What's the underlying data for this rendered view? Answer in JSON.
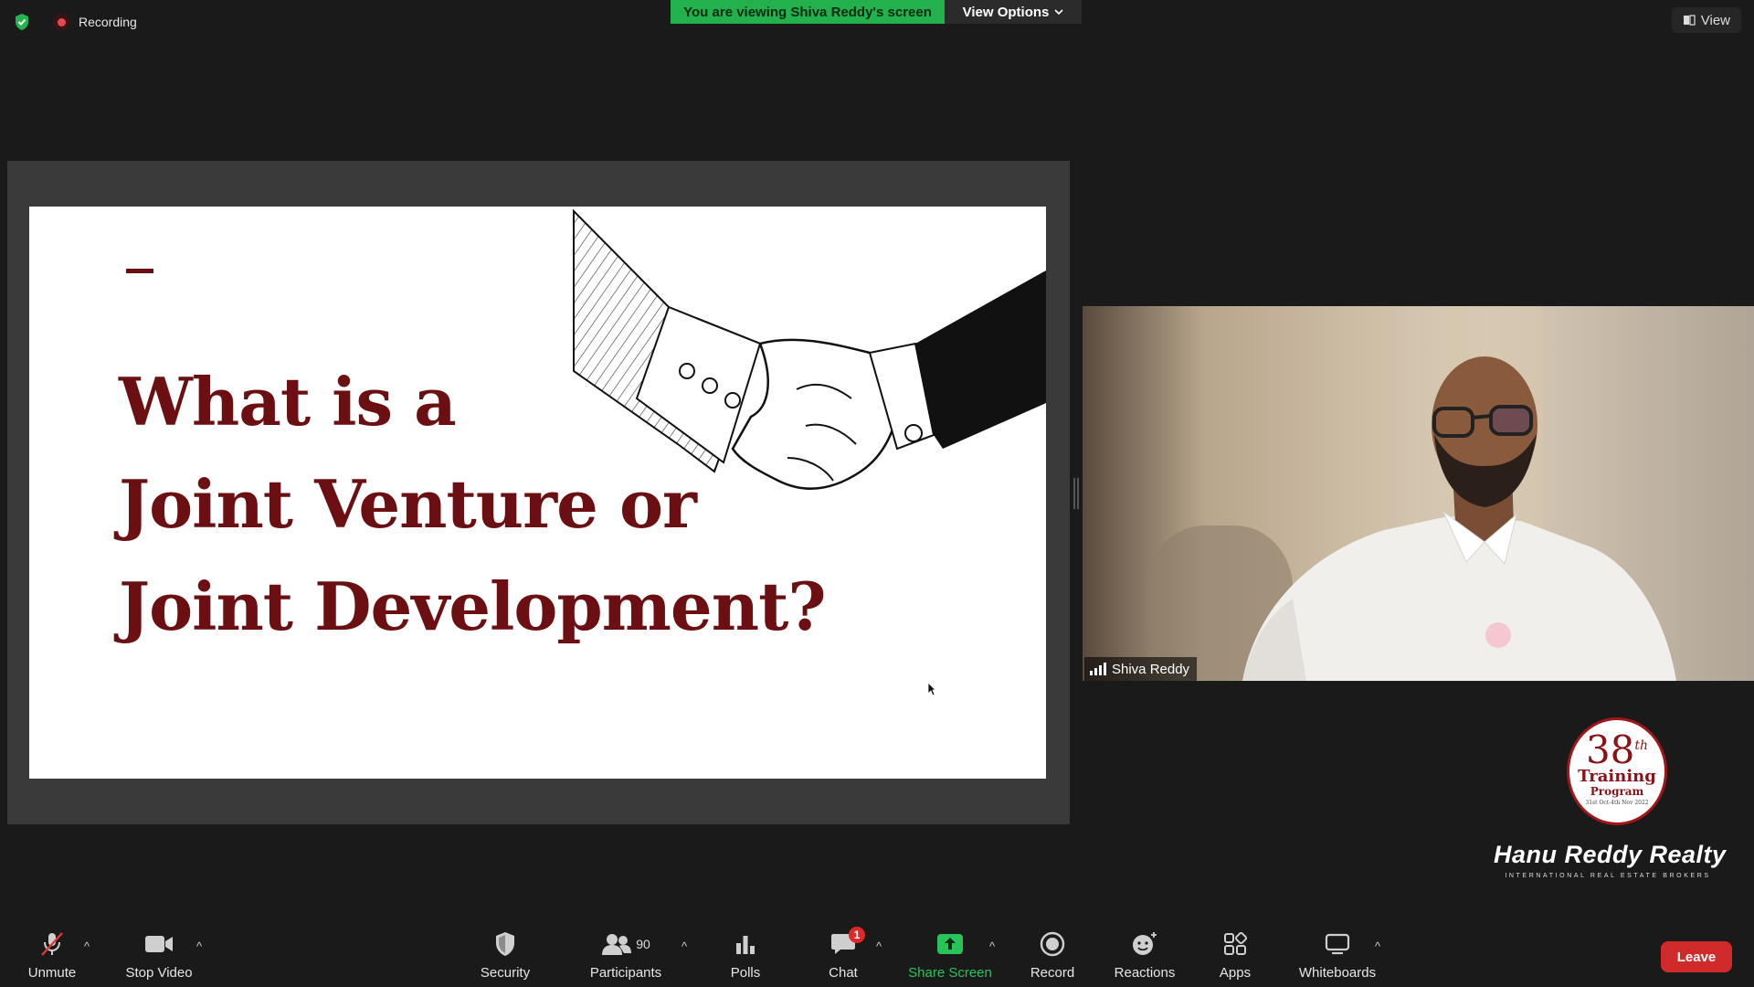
{
  "top_bar": {
    "recording_label": "Recording",
    "viewing_banner": "You are viewing Shiva Reddy's screen",
    "view_options_label": "View Options",
    "view_label": "View"
  },
  "slide": {
    "dash": "–",
    "title_lines": [
      "What is a",
      "Joint Venture or",
      "Joint Development?"
    ],
    "title_color": "#6b0f12"
  },
  "participant_video": {
    "name": "Shiva Reddy"
  },
  "logo": {
    "seal_number": "38",
    "seal_suffix": "th",
    "seal_line1": "Training",
    "seal_line2": "Program",
    "seal_dates": "31st Oct-4th Nov 2022",
    "brand_name": "Hanu Reddy Realty",
    "tagline": "INTERNATIONAL REAL ESTATE BROKERS"
  },
  "toolbar": {
    "unmute": "Unmute",
    "stop_video": "Stop Video",
    "security": "Security",
    "participants": "Participants",
    "participants_count": "90",
    "polls": "Polls",
    "chat": "Chat",
    "chat_badge": "1",
    "share_screen": "Share Screen",
    "record": "Record",
    "reactions": "Reactions",
    "apps": "Apps",
    "whiteboards": "Whiteboards",
    "leave": "Leave"
  },
  "colors": {
    "banner_green": "#22b14c",
    "share_green": "#27c45a",
    "leave_red": "#d12a2a",
    "accent_maroon": "#6b0f12"
  },
  "icons": [
    "shield-check-icon",
    "recording-icon",
    "view-icon",
    "mic-muted-icon",
    "camera-icon",
    "security-shield-icon",
    "participants-icon",
    "polls-icon",
    "chat-icon",
    "share-screen-icon",
    "record-icon",
    "reactions-icon",
    "apps-icon",
    "whiteboard-icon",
    "signal-icon",
    "cursor-icon"
  ]
}
